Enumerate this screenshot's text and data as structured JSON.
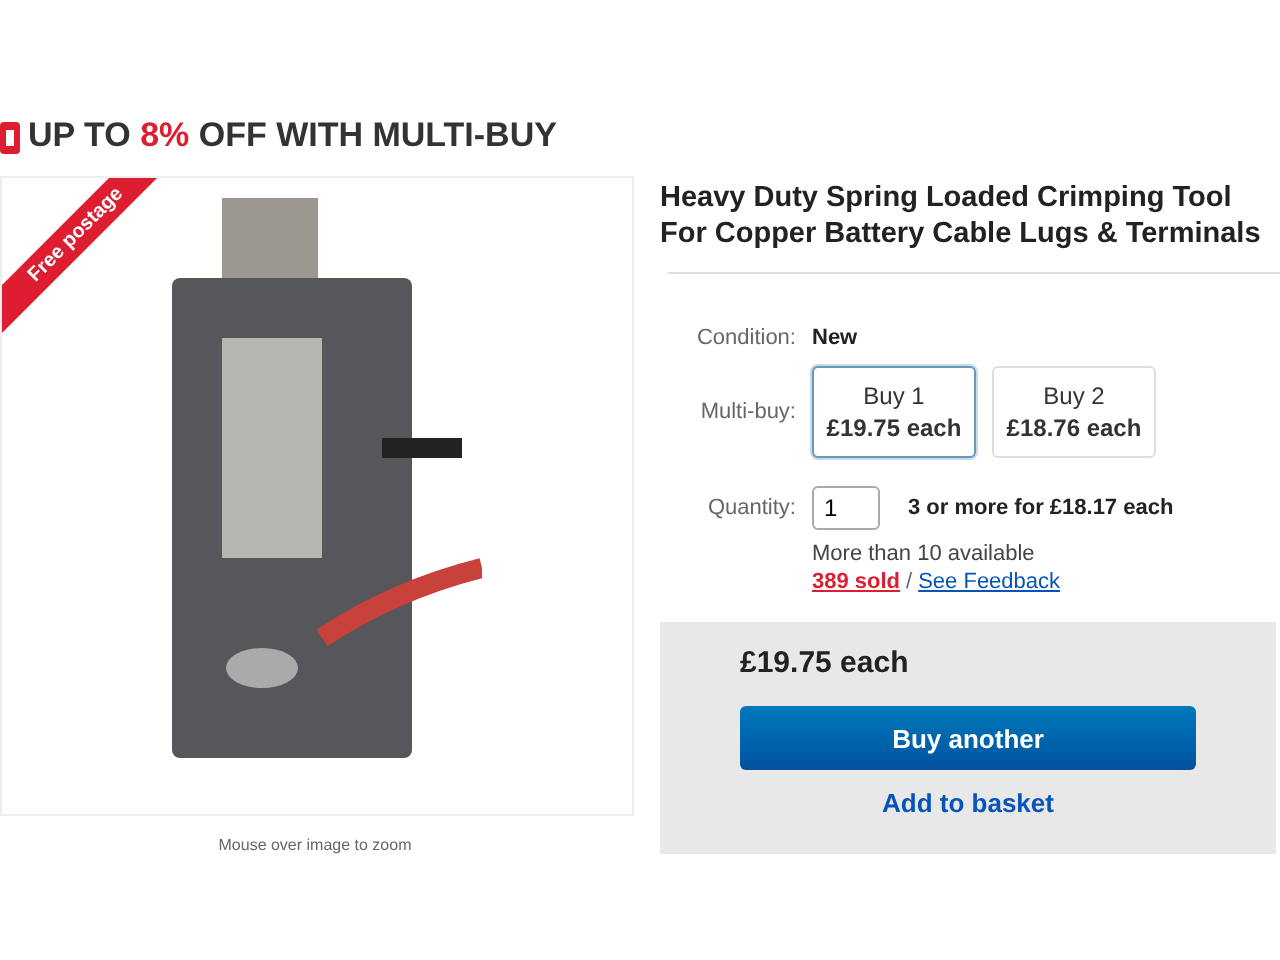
{
  "promo": {
    "before": "UP TO ",
    "highlight": "8%",
    "after": " OFF WITH MULTI-BUY"
  },
  "gallery": {
    "ribbon": "Free postage",
    "hint": "Mouse over image to zoom"
  },
  "listing": {
    "title": "Heavy Duty Spring Loaded Crimping Tool For Copper Battery Cable Lugs & Terminals",
    "condition": {
      "label": "Condition:",
      "value": "New"
    },
    "multibuy": {
      "label": "Multi-buy:",
      "options": [
        {
          "qty": "Buy 1",
          "price": "£19.75 each",
          "selected": true
        },
        {
          "qty": "Buy 2",
          "price": "£18.76 each",
          "selected": false
        }
      ]
    },
    "quantity": {
      "label": "Quantity:",
      "value": "1",
      "offer": "3 or more for £18.17 each"
    },
    "availability": "More than 10 available",
    "sold": "389 sold",
    "separator": "/",
    "feedback": "See Feedback"
  },
  "purchase": {
    "price": "£19.75 each",
    "primary": "Buy another",
    "secondary": "Add to basket"
  }
}
